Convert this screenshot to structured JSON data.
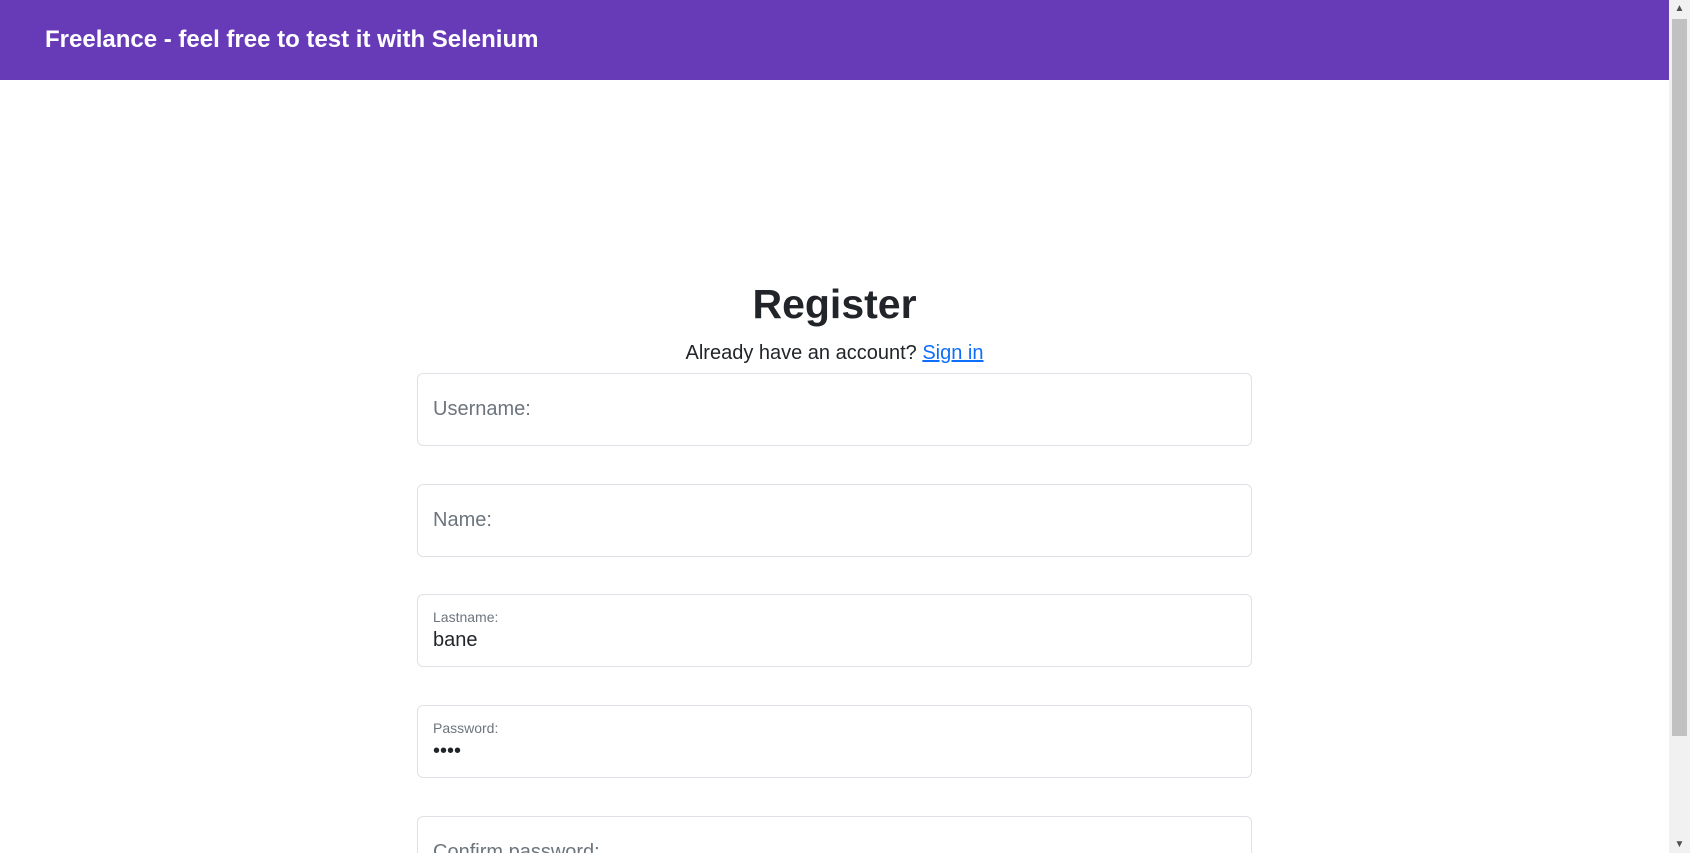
{
  "navbar": {
    "brand": "Freelance - feel free to test it with Selenium"
  },
  "page": {
    "title": "Register",
    "subtitle_text": "Already have an account? ",
    "signin_link": "Sign in"
  },
  "form": {
    "username": {
      "label": "Username:",
      "value": ""
    },
    "name": {
      "label": "Name:",
      "value": ""
    },
    "lastname": {
      "label": "Lastname:",
      "value": "bane"
    },
    "password": {
      "label": "Password:",
      "value": "••••"
    },
    "confirm_password": {
      "label": "Confirm password:",
      "value": ""
    }
  },
  "colors": {
    "navbar": "#673ab7",
    "link": "#0d6efd"
  },
  "icons": {
    "scroll_up": "triangle-up-icon",
    "scroll_down": "triangle-down-icon"
  }
}
